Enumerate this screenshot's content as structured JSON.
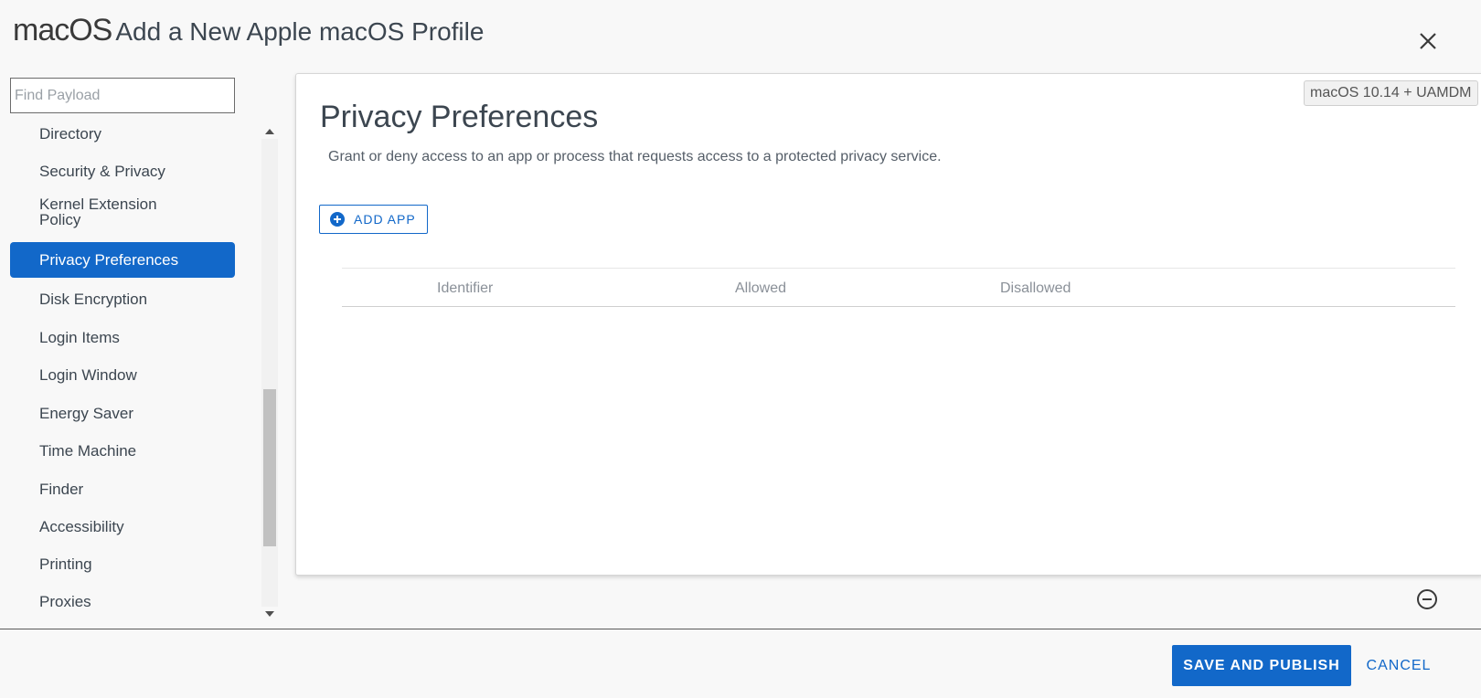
{
  "header": {
    "brand": "macOS",
    "title": "Add a New Apple macOS Profile"
  },
  "sidebar": {
    "search_placeholder": "Find Payload",
    "items": [
      {
        "label": "Directory"
      },
      {
        "label": "Security & Privacy"
      },
      {
        "label": "Kernel Extension Policy"
      },
      {
        "label": "Privacy Preferences",
        "active": true
      },
      {
        "label": "Disk Encryption"
      },
      {
        "label": "Login Items"
      },
      {
        "label": "Login Window"
      },
      {
        "label": "Energy Saver"
      },
      {
        "label": "Time Machine"
      },
      {
        "label": "Finder"
      },
      {
        "label": "Accessibility"
      },
      {
        "label": "Printing"
      },
      {
        "label": "Proxies"
      }
    ]
  },
  "main": {
    "version_badge": "macOS 10.14 + UAMDM",
    "title": "Privacy Preferences",
    "description": "Grant or deny access to an app or process that requests access to a protected privacy service.",
    "add_app_label": "ADD APP",
    "table": {
      "columns": [
        "Identifier",
        "Allowed",
        "Disallowed"
      ],
      "rows": []
    }
  },
  "footer": {
    "save_label": "SAVE AND PUBLISH",
    "cancel_label": "CANCEL"
  },
  "colors": {
    "accent": "#1268c9",
    "text": "#3c4650",
    "background": "#f8f8f8"
  },
  "icons": {
    "close": "close-icon",
    "add": "plus-circle-icon",
    "remove": "minus-circle-icon",
    "scroll_up": "caret-up-icon",
    "scroll_down": "caret-down-icon"
  }
}
